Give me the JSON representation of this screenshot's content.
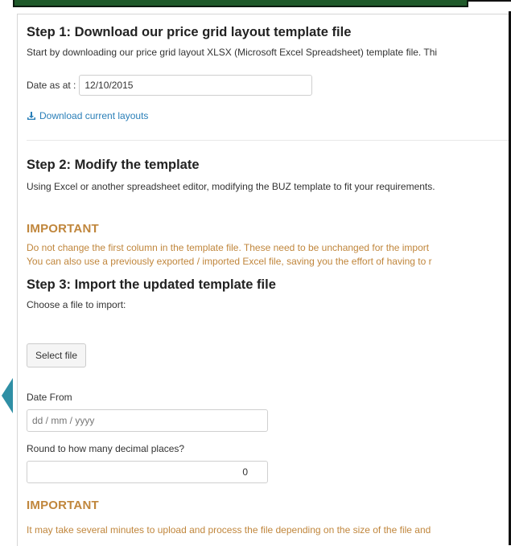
{
  "step1": {
    "title": "Step 1: Download our price grid layout template file",
    "description": "Start by downloading our price grid layout XLSX (Microsoft Excel Spreadsheet) template file. Thi",
    "date_label": "Date as at :",
    "date_value": "12/10/2015",
    "download_link": "Download current layouts"
  },
  "step2": {
    "title": "Step 2: Modify the template",
    "description": "Using Excel or another spreadsheet editor, modifying the BUZ template to fit your requirements."
  },
  "important1": {
    "title": "IMPORTANT",
    "line1": "Do not change the first column in the template file. These need to be unchanged for the import",
    "line2": "You can also use a previously exported / imported Excel file, saving you the effort of having to r"
  },
  "step3": {
    "title": "Step 3: Import the updated template file",
    "choose_label": "Choose a file to import:",
    "select_button": "Select file",
    "date_from_label": "Date From",
    "date_from_placeholder": "dd / mm / yyyy",
    "round_label": "Round to how many decimal places?",
    "round_value": "0"
  },
  "important2": {
    "title": "IMPORTANT",
    "line": "It may take several minutes to upload and process the file depending on the size of the file and"
  },
  "colors": {
    "accent_link": "#2a7fb8",
    "warning": "#c0863c",
    "header_bar": "#1f5a2a",
    "arrow": "#2f8fa5"
  }
}
